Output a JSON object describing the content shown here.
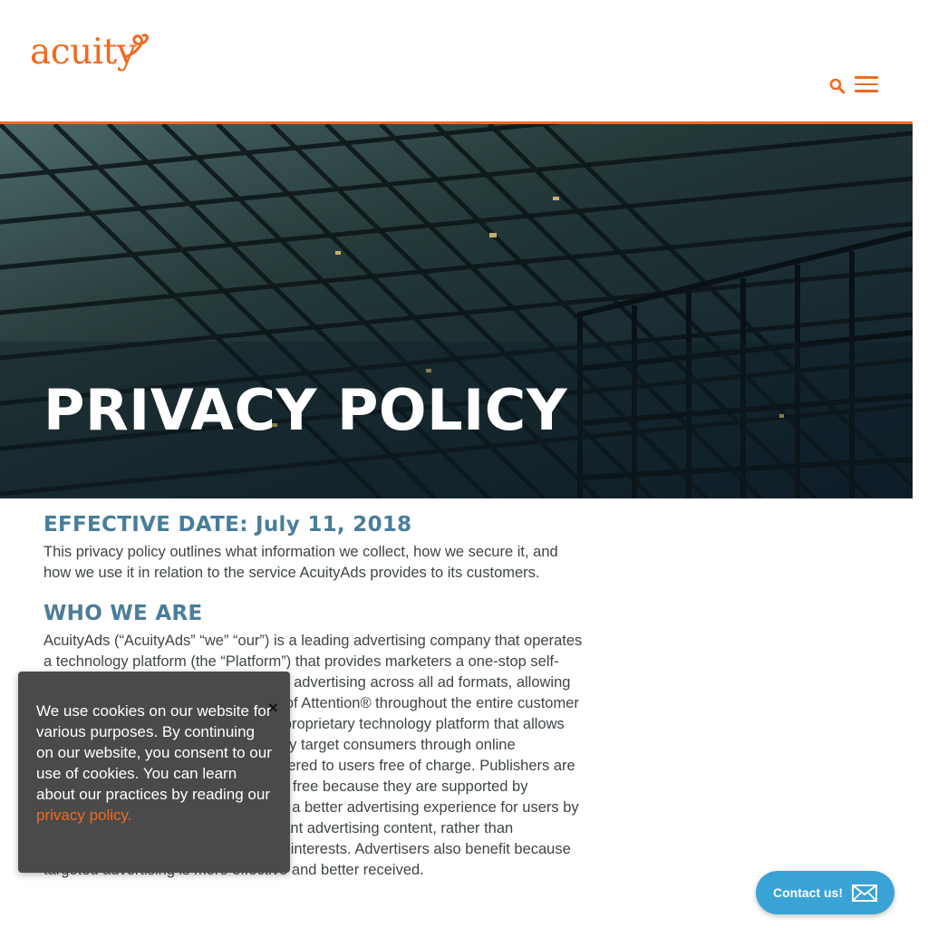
{
  "header": {
    "logo_text": "acuity",
    "search_icon": "search-icon",
    "menu_icon": "hamburger-menu-icon"
  },
  "hero": {
    "title": "PRIVACY POLICY"
  },
  "content": {
    "effective_date": "EFFECTIVE DATE: July 11, 2018",
    "intro": "This privacy policy outlines what information we collect, how we secure it, and how we use it in relation to the service AcuityAds provides to its customers.",
    "who_heading": "WHO WE ARE",
    "who_text": "AcuityAds (“AcuityAds” “we” “our”) is a leading advertising company that operates a technology platform (the “Platform”) that provides marketers a one-stop self-serve omnichannel solution for digital advertising across all ad formats, allowing them to maximize Reach and Share of Attention® throughout the entire customer journey. AcuityAds has developed a proprietary technology platform that allows advertisers and agencies to effectively target consumers through online advertising. Most of the internet is offered to users free of charge. Publishers are only able to offer valuable content for free because they are supported by advertising. AcuityAds aims to create a better advertising experience for users by allowing advertisers to present relevant advertising content, rather than advertising that is unrelated to users’ interests. Advertisers also benefit because targeted advertising is more effective and better received."
  },
  "cookie_banner": {
    "message": "We use cookies on our website for various purposes. By continuing on our website, you consent to our use of cookies. You can learn about our practices by reading our ",
    "link_text": "privacy policy.",
    "close_label": "×",
    "close_icon": "close-icon"
  },
  "contact": {
    "label": "Contact us!",
    "icon": "envelope-icon"
  },
  "colors": {
    "brand_orange": "#f26a21",
    "heading_blue": "#4a7d9a",
    "contact_blue": "#3aa3d6",
    "cookie_bg": "#4a4a4a"
  }
}
